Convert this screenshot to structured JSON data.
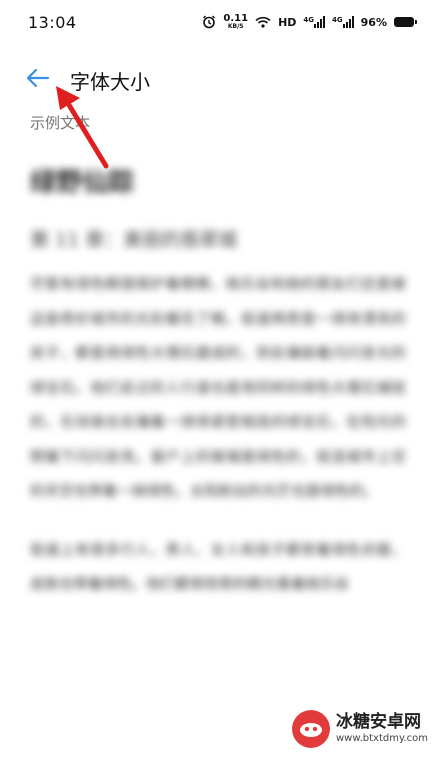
{
  "status_bar": {
    "time": "13:04",
    "net_speed_value": "0.11",
    "net_speed_unit": "KB/S",
    "hd": "HD",
    "net_type_1": "4G",
    "net_type_2": "4G",
    "battery_percent": "96%"
  },
  "header": {
    "back_icon": "arrow-left-icon",
    "title": "字体大小"
  },
  "preview": {
    "label": "示例文本",
    "book_title": "绿野仙踪",
    "chapter_title": "第 11 章：美丽的翡翠城",
    "paragraph_1": "尽管有绿色眼镜保护着眼睛，桃乐丝和她的朋友们还是被这座奇妙城市的光彩耀花了眼。街道两旁是一排排漂亮的房子，都是用绿色大理石建成的，到处镶嵌着闪闪发光的绿宝石。他们走过的人行道也是用同样的绿色大理石铺就的，石块接合处镶着一排排紧密相连的绿宝石，在阳光的照耀下闪闪发亮。窗户上的玻璃是绿色的，就连城市上空的天空也带着一抹绿色，太阳射出的光芒也是绿色的。",
    "paragraph_2": "街道上有很多行人，男人、女人和孩子都穿着绿色衣服，皮肤也带着绿色。他们都用惊奇的眼光看着桃乐丝"
  },
  "watermark": {
    "title": "冰糖安卓网",
    "url": "www.btxtdmy.com"
  },
  "colors": {
    "accent_blue": "#3a8ee6",
    "annotation_red": "#e02020"
  }
}
